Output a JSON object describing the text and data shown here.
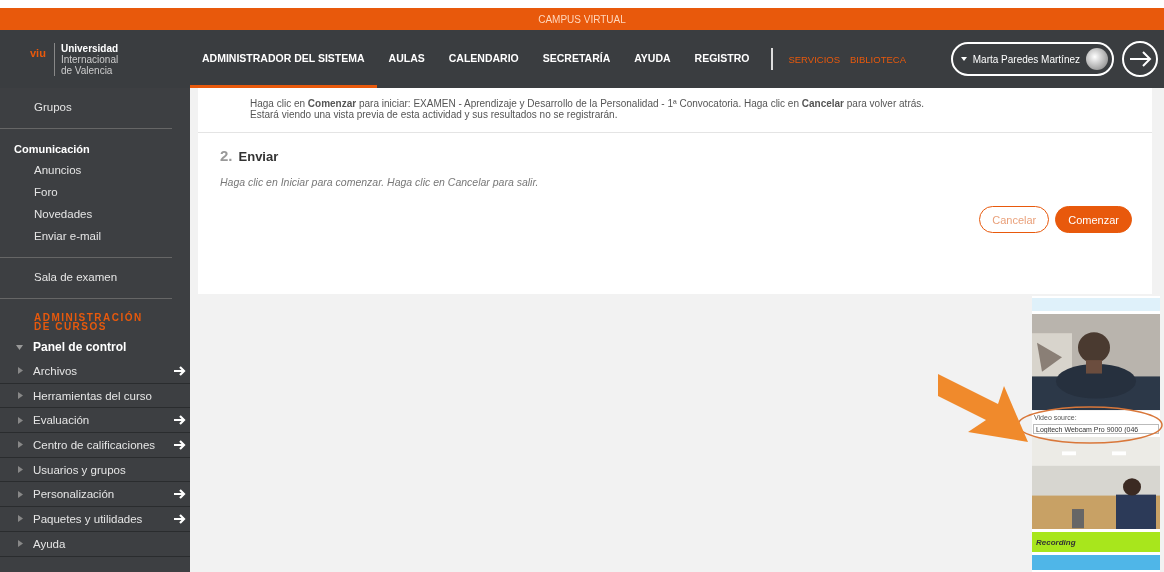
{
  "top_bar": {
    "title": "CAMPUS VIRTUAL"
  },
  "logo": {
    "mark": "viu",
    "name": "Universidad",
    "lines": [
      "Internacional",
      "de Valencia"
    ]
  },
  "nav": {
    "items": [
      {
        "label": "ADMINISTRADOR DEL SISTEMA",
        "selected": true
      },
      {
        "label": "AULAS",
        "selected": false
      },
      {
        "label": "CALENDARIO",
        "selected": false
      },
      {
        "label": "SECRETARÍA",
        "selected": false
      },
      {
        "label": "AYUDA",
        "selected": false
      },
      {
        "label": "REGISTRO",
        "selected": false
      }
    ],
    "links": [
      "SERVICIOS",
      "BIBLIOTECA"
    ]
  },
  "user": {
    "name": "Marta Paredes Martínez"
  },
  "sidebar": {
    "sections": [
      {
        "items": [
          {
            "label": "Grupos"
          }
        ]
      },
      {
        "heading": "Comunicación",
        "items": [
          {
            "label": "Anuncios"
          },
          {
            "label": "Foro"
          },
          {
            "label": "Novedades"
          },
          {
            "label": "Enviar e-mail"
          }
        ]
      },
      {
        "items": [
          {
            "label": "Sala de examen"
          }
        ]
      }
    ],
    "admin": {
      "heading": "ADMINISTRACIÓN DE CURSOS",
      "panel": {
        "label": "Panel de control",
        "expanded": true
      },
      "items": [
        {
          "label": "Archivos",
          "arrow": true
        },
        {
          "label": "Herramientas del curso",
          "arrow": false
        },
        {
          "label": "Evaluación",
          "arrow": true
        },
        {
          "label": "Centro de calificaciones",
          "arrow": true
        },
        {
          "label": "Usuarios y grupos",
          "arrow": false
        },
        {
          "label": "Personalización",
          "arrow": true
        },
        {
          "label": "Paquetes y utilidades",
          "arrow": true
        },
        {
          "label": "Ayuda",
          "arrow": false
        }
      ]
    }
  },
  "content": {
    "intro": "Haga clic en **Comenzar** para iniciar: EXAMEN - Aprendizaje y Desarrollo de la Personalidad - 1ª Convocatoria. Haga clic en **Cancelar** para volver atrás.",
    "note": "Estará viendo una vista previa de esta actividad y sus resultados no se registrarán.",
    "step": {
      "number": "2.",
      "title": "Enviar",
      "text": "Haga clic en Iniciar para comenzar. Haga clic en Cancelar para salir."
    },
    "buttons": [
      {
        "label": "Cancelar",
        "kind": "secondary"
      },
      {
        "label": "Comenzar",
        "kind": "primary"
      }
    ]
  },
  "webcam": {
    "source_label": "Video source:",
    "source_value": "Logitech Webcam Pro 9000 (046",
    "status": "Recording"
  }
}
